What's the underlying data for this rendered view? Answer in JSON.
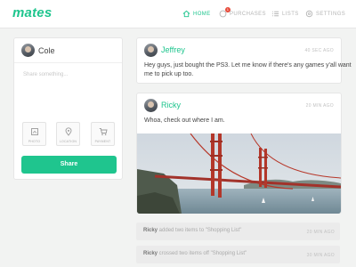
{
  "app": {
    "logo": "mates"
  },
  "nav": {
    "home": "HOME",
    "purchases": "PURCHASES",
    "purchases_badge": "1",
    "lists": "LISTS",
    "settings": "SETTINGS"
  },
  "composer": {
    "user": "Cole",
    "placeholder": "Share something...",
    "attachments": [
      "PHOTO",
      "LOCATION",
      "PAYMENT"
    ],
    "share_label": "Share"
  },
  "posts": [
    {
      "user": "Jeffrey",
      "time": "40 SEC AGO",
      "text_line1": "Hey guys, just bought the PS3. Let me know if there's any games y'all want",
      "text_line2": "me to pick up too."
    },
    {
      "user": "Ricky",
      "time": "20 MIN AGO",
      "text": "Whoa, check out where I am."
    }
  ],
  "activity": [
    {
      "user": "Ricky",
      "action": " added two items to \"Shopping List\"",
      "time": "20 MIN AGO"
    },
    {
      "user": "Ricky",
      "action": " crossed two items off \"Shopping List\"",
      "time": "30 MIN AGO"
    }
  ],
  "colors": {
    "accent": "#1fc58e",
    "badge": "#e74c3c"
  }
}
